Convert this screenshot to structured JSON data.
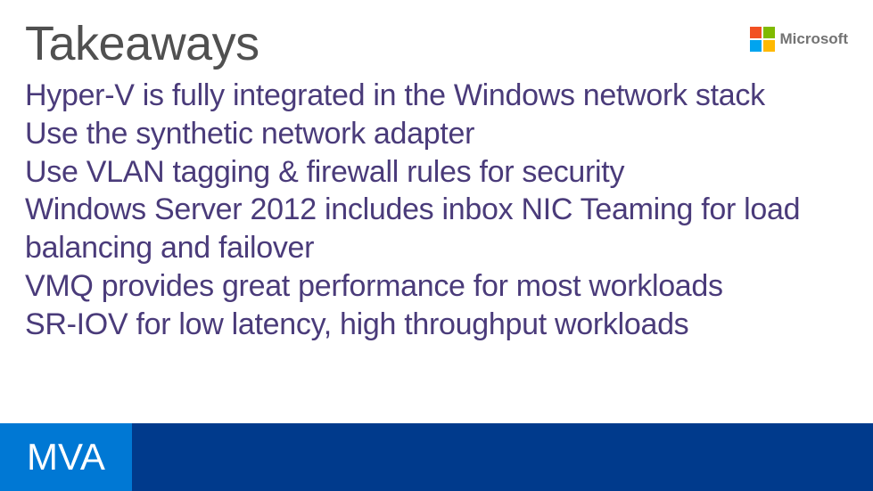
{
  "header": {
    "title": "Takeaways",
    "brand": "Microsoft"
  },
  "content": {
    "bullets": [
      "Hyper-V is fully integrated in the Windows network stack",
      "Use the synthetic network adapter",
      "Use VLAN tagging & firewall rules for security",
      "Windows Server 2012 includes inbox NIC Teaming for load balancing and failover",
      "VMQ provides great performance for most workloads",
      "SR-IOV for low latency, high throughput workloads"
    ]
  },
  "footer": {
    "mva": "MVA"
  },
  "colors": {
    "title_gray": "#505050",
    "body_purple": "#4a3b7a",
    "mva_blue": "#0078d4",
    "dark_blue": "#003a8c",
    "ms_red": "#f25022",
    "ms_green": "#7fba00",
    "ms_blue": "#00a4ef",
    "ms_yellow": "#ffb900"
  }
}
